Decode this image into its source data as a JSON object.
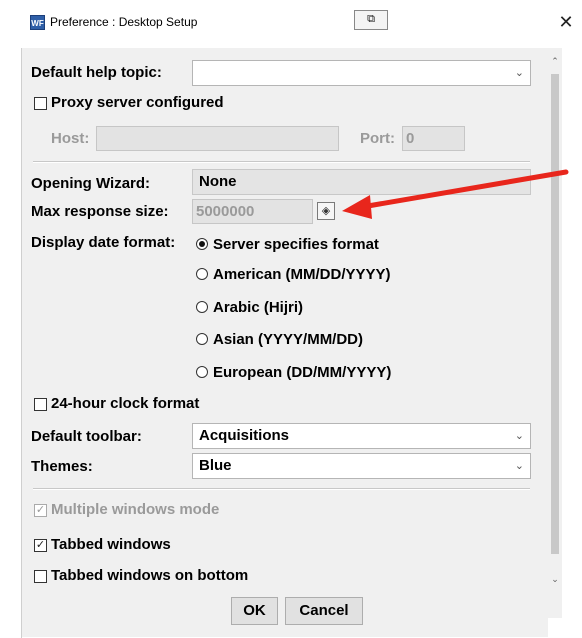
{
  "window": {
    "app_icon": "WF",
    "title": "Preference : Desktop Setup",
    "close_glyph": "✕",
    "restore_glyph": "⧉"
  },
  "help": {
    "label": "Default help topic:",
    "value": ""
  },
  "proxy": {
    "label": "Proxy server configured",
    "checked": false,
    "host_label": "Host:",
    "host_value": "",
    "port_label": "Port:",
    "port_value": "0"
  },
  "wizard": {
    "label": "Opening Wizard:",
    "value": "None"
  },
  "max_response": {
    "label": "Max response size:",
    "value": "5000000"
  },
  "date_format": {
    "label": "Display date format:",
    "options": [
      {
        "label": "Server specifies format",
        "selected": true
      },
      {
        "label": "American (MM/DD/YYYY)",
        "selected": false
      },
      {
        "label": "Arabic (Hijri)",
        "selected": false
      },
      {
        "label": "Asian (YYYY/MM/DD)",
        "selected": false
      },
      {
        "label": "European (DD/MM/YYYY)",
        "selected": false
      }
    ]
  },
  "clock": {
    "label": "24-hour clock format",
    "checked": false
  },
  "toolbar": {
    "label": "Default toolbar:",
    "value": "Acquisitions"
  },
  "themes": {
    "label": "Themes:",
    "value": "Blue"
  },
  "windows": {
    "multiple_label": "Multiple windows mode",
    "multiple_checked": true,
    "tabbed_label": "Tabbed windows",
    "tabbed_checked": true,
    "tabbed_bottom_label": "Tabbed windows on bottom",
    "tabbed_bottom_checked": false
  },
  "buttons": {
    "ok": "OK",
    "cancel": "Cancel"
  },
  "colors": {
    "annotation_arrow": "#e8261c"
  }
}
